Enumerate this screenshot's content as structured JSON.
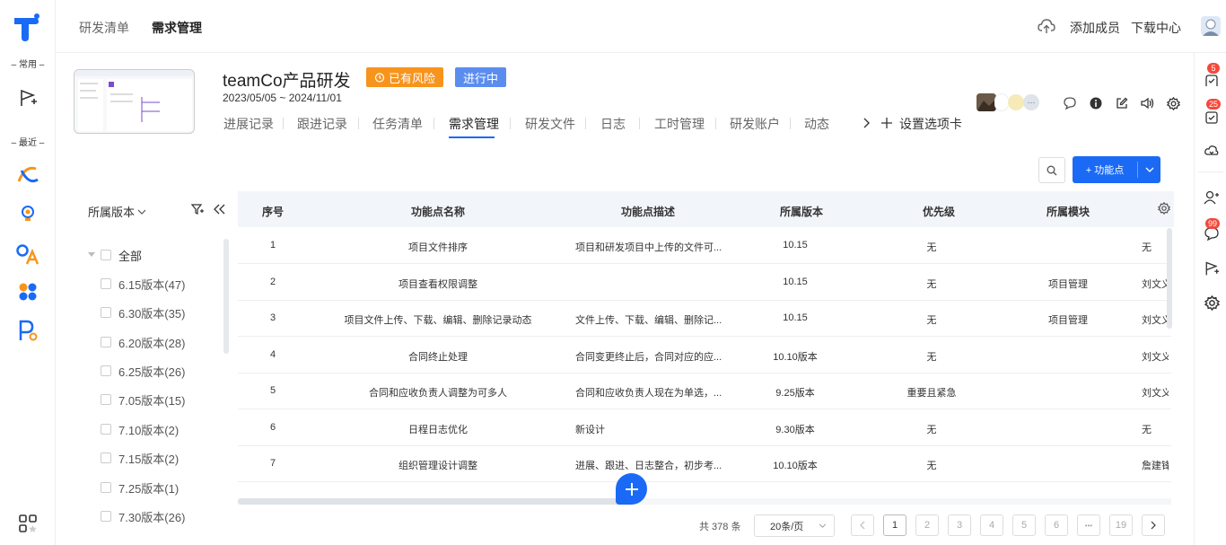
{
  "leftbar": {
    "section_common": "– 常用 –",
    "section_recent": "– 最近 –"
  },
  "topbar": {
    "nav1": "研发清单",
    "nav2": "需求管理",
    "add_member": "添加成员",
    "download_center": "下载中心"
  },
  "project": {
    "title": "teamCo产品研发",
    "risk_badge": "已有风险",
    "status_badge": "进行中",
    "dates": "2023/05/05 ~ 2024/11/01",
    "tabs": [
      "进展记录",
      "跟进记录",
      "任务清单",
      "需求管理",
      "研发文件",
      "日志",
      "工时管理",
      "研发账户",
      "动态"
    ],
    "tab_settings": "设置选项卡"
  },
  "toolbar": {
    "add_label": "+ 功能点"
  },
  "filter": {
    "title": "所属版本",
    "all": "全部",
    "versions": [
      "6.15版本(47)",
      "6.30版本(35)",
      "6.20版本(28)",
      "6.25版本(26)",
      "7.05版本(15)",
      "7.10版本(2)",
      "7.15版本(2)",
      "7.25版本(1)",
      "7.30版本(26)"
    ]
  },
  "table": {
    "headers": {
      "no": "序号",
      "name": "功能点名称",
      "desc": "功能点描述",
      "version": "所属版本",
      "priority": "优先级",
      "module": "所属模块"
    },
    "rows": [
      {
        "no": "1",
        "name": "项目文件排序",
        "desc": "项目和研发项目中上传的文件可...",
        "version": "10.15",
        "priority": "无",
        "module": "",
        "owner": "无"
      },
      {
        "no": "2",
        "name": "项目查看权限调整",
        "desc": "",
        "version": "10.15",
        "priority": "无",
        "module": "项目管理",
        "owner": "刘文义"
      },
      {
        "no": "3",
        "name": "项目文件上传、下载、编辑、删除记录动态",
        "desc": "文件上传、下载、编辑、删除记...",
        "version": "10.15",
        "priority": "无",
        "module": "项目管理",
        "owner": "刘文义"
      },
      {
        "no": "4",
        "name": "合同终止处理",
        "desc": "合同变更终止后，合同对应的应...",
        "version": "10.10版本",
        "priority": "无",
        "module": "",
        "owner": "刘文义"
      },
      {
        "no": "5",
        "name": "合同和应收负责人调整为可多人",
        "desc": "合同和应收负责人现在为单选，...",
        "version": "9.25版本",
        "priority": "重要且紧急",
        "module": "",
        "owner": "刘文义"
      },
      {
        "no": "6",
        "name": "日程日志优化",
        "desc": "新设计",
        "version": "9.30版本",
        "priority": "无",
        "module": "",
        "owner": "无"
      },
      {
        "no": "7",
        "name": "组织管理设计调整",
        "desc": "进展、跟进、日志整合，初步考...",
        "version": "10.10版本",
        "priority": "无",
        "module": "",
        "owner": "詹建锋"
      }
    ]
  },
  "pagination": {
    "total": "共 378 条",
    "page_size": "20条/页",
    "pages": [
      "1",
      "2",
      "3",
      "4",
      "5",
      "6",
      "•••",
      "19"
    ]
  },
  "rightbar": {
    "badge1": "5",
    "badge2": "25",
    "badge3": "99"
  },
  "colors": {
    "accent": "#1a6af5",
    "risk": "#f7941d",
    "status": "#5b8def"
  }
}
